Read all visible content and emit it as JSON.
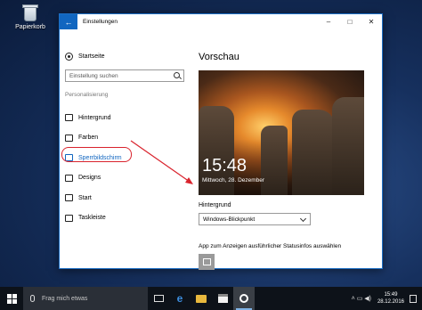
{
  "desktop": {
    "recycle_bin_label": "Papierkorb"
  },
  "window": {
    "title": "Einstellungen",
    "back_label": "←",
    "minimize": "–",
    "maximize": "□",
    "close": "✕"
  },
  "sidebar": {
    "home_label": "Startseite",
    "search_placeholder": "Einstellung suchen",
    "section_label": "Personalisierung",
    "items": [
      {
        "label": "Hintergrund",
        "icon": "image-icon"
      },
      {
        "label": "Farben",
        "icon": "palette-icon"
      },
      {
        "label": "Sperrbildschirm",
        "icon": "lockscreen-icon",
        "active": true
      },
      {
        "label": "Designs",
        "icon": "brush-icon"
      },
      {
        "label": "Start",
        "icon": "start-icon"
      },
      {
        "label": "Taskleiste",
        "icon": "taskbar-icon"
      }
    ]
  },
  "content": {
    "preview_title": "Vorschau",
    "lock_time": "15:48",
    "lock_date": "Mittwoch, 28. Dezember",
    "background_label": "Hintergrund",
    "background_value": "Windows-Blickpunkt",
    "app_status_label": "App zum Anzeigen ausführlicher Statusinfos auswählen"
  },
  "annotation": {
    "highlight_color": "#d9232d"
  },
  "taskbar": {
    "search_placeholder": "Frag mich etwas",
    "time": "15:49",
    "date": "28.12.2016",
    "tray_symbols": "˄ ▭ ◀)"
  },
  "colors": {
    "accent": "#1166c0",
    "taskbar": "#0d1219"
  }
}
